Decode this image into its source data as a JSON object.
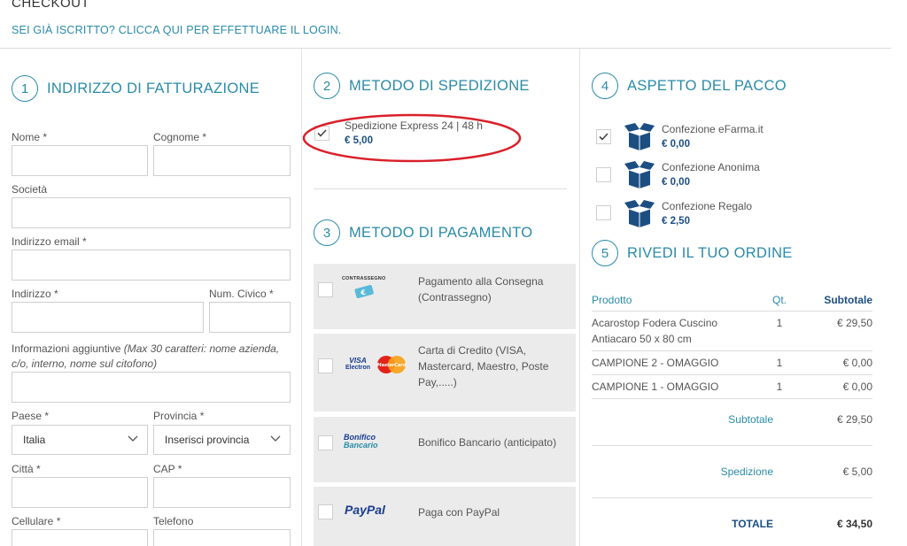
{
  "header": {
    "title": "CHECKOUT",
    "login_link": "SEI GIÀ ISCRITTO? CLICCA QUI PER EFFETTUARE IL LOGIN."
  },
  "billing": {
    "number": "1",
    "title": "INDIRIZZO DI FATTURAZIONE",
    "fields": {
      "nome": "Nome *",
      "cognome": "Cognome *",
      "societa": "Società",
      "email": "Indirizzo email *",
      "indirizzo": "Indirizzo *",
      "civico": "Num. Civico *",
      "info_main": "Informazioni aggiuntive ",
      "info_hint": "(Max 30 caratteri: nome azienda, c/o, interno, nome sul citofono)",
      "paese": "Paese *",
      "paese_value": "Italia",
      "provincia": "Provincia *",
      "provincia_value": "Inserisci provincia",
      "citta": "Città *",
      "cap": "CAP *",
      "cellulare": "Cellulare *",
      "telefono": "Telefono"
    }
  },
  "shipping": {
    "number": "2",
    "title": "METODO DI SPEDIZIONE",
    "option_name": "Spedizione Express 24 | 48 h",
    "option_price": "€ 5,00",
    "checked": true
  },
  "payment": {
    "number": "3",
    "title": "METODO DI PAGAMENTO",
    "options": [
      {
        "label": "Pagamento alla Consegna (Contrassegno)",
        "logo": "CONTRASSEGNO"
      },
      {
        "label": "Carta di Credito (VISA, Mastercard, Maestro, Poste Pay,.....)",
        "logo_visa": "VISA",
        "logo_electron": "Electron",
        "logo_mc": "MasterCard"
      },
      {
        "label": "Bonifico Bancario (anticipato)",
        "logo1": "Bonifico",
        "logo2": "Bancario"
      },
      {
        "label": "Paga con PayPal",
        "logo": "PayPal"
      }
    ]
  },
  "package": {
    "number": "4",
    "title": "ASPETTO DEL PACCO",
    "options": [
      {
        "name": "Confezione eFarma.it",
        "price": "€ 0,00",
        "checked": true
      },
      {
        "name": "Confezione Anonima",
        "price": "€ 0,00",
        "checked": false
      },
      {
        "name": "Confezione Regalo",
        "price": "€ 2,50",
        "checked": false
      }
    ]
  },
  "review": {
    "number": "5",
    "title": "RIVEDI IL TUO ORDINE",
    "columns": {
      "product": "Prodotto",
      "qty": "Qt.",
      "subtotal": "Subtotale"
    },
    "rows": [
      {
        "product": "Acarostop Fodera Cuscino Antiacaro 50 x 80 cm",
        "qty": "1",
        "subtotal": "€ 29,50"
      },
      {
        "product": "CAMPIONE 2 - OMAGGIO",
        "qty": "1",
        "subtotal": "€ 0,00"
      },
      {
        "product": "CAMPIONE 1 - OMAGGIO",
        "qty": "1",
        "subtotal": "€ 0,00"
      }
    ],
    "subtotal_label": "Subtotale",
    "subtotal_value": "€ 29,50",
    "shipping_label": "Spedizione",
    "shipping_value": "€ 5,00",
    "total_label": "TOTALE",
    "total_value": "€ 34,50"
  },
  "colors": {
    "accent": "#2a8ba8",
    "price": "#1c4e82",
    "highlight": "#d9202a",
    "card_bg": "#ebebeb"
  }
}
